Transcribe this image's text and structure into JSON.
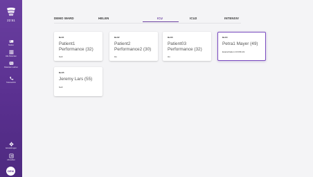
{
  "sidebar": {
    "clock": "22:51",
    "items": [
      {
        "label": "Station",
        "icon": "bed-icon"
      },
      {
        "label": "Alle Patienten",
        "icon": "grid-icon"
      },
      {
        "label": "Patienten suchen",
        "icon": "id-card-icon"
      },
      {
        "label": "Telemedizin",
        "icon": "phone-icon"
      }
    ],
    "bottom_items": [
      {
        "label": "Einstellungen",
        "icon": "gear-icon"
      },
      {
        "label": "Abmelden",
        "icon": "logout-icon"
      }
    ],
    "avatar_initials": "DEM"
  },
  "tabs": [
    {
      "label": "DEMO WARD",
      "active": false
    },
    {
      "label": "HELEN",
      "active": false
    },
    {
      "label": "ICU",
      "active": true
    },
    {
      "label": "ICU2",
      "active": false
    },
    {
      "label": "INTENSIV",
      "active": false
    }
  ],
  "patients": [
    {
      "bed": "Bett1",
      "name": "Patient1 Performance (32)",
      "note": "Gelt",
      "selected": false
    },
    {
      "bed": "Bett2",
      "name": "Patient2 Performance2 (30)",
      "note": "Hu",
      "selected": false
    },
    {
      "bed": "Bett3",
      "name": "Patient03 Performance (32)",
      "note": "Hu",
      "selected": false
    },
    {
      "bed": "Bett4",
      "name": "Petra1 Mayer (49)",
      "note": "Exazerbation COVID-19",
      "selected": true
    },
    {
      "bed": "Bett5",
      "name": "Jeremy Lars (55)",
      "note": "Gelt",
      "selected": false
    }
  ],
  "colors": {
    "accent": "#6a3fa0",
    "sidebar": "#5a3090",
    "background": "#f4f4f6"
  }
}
